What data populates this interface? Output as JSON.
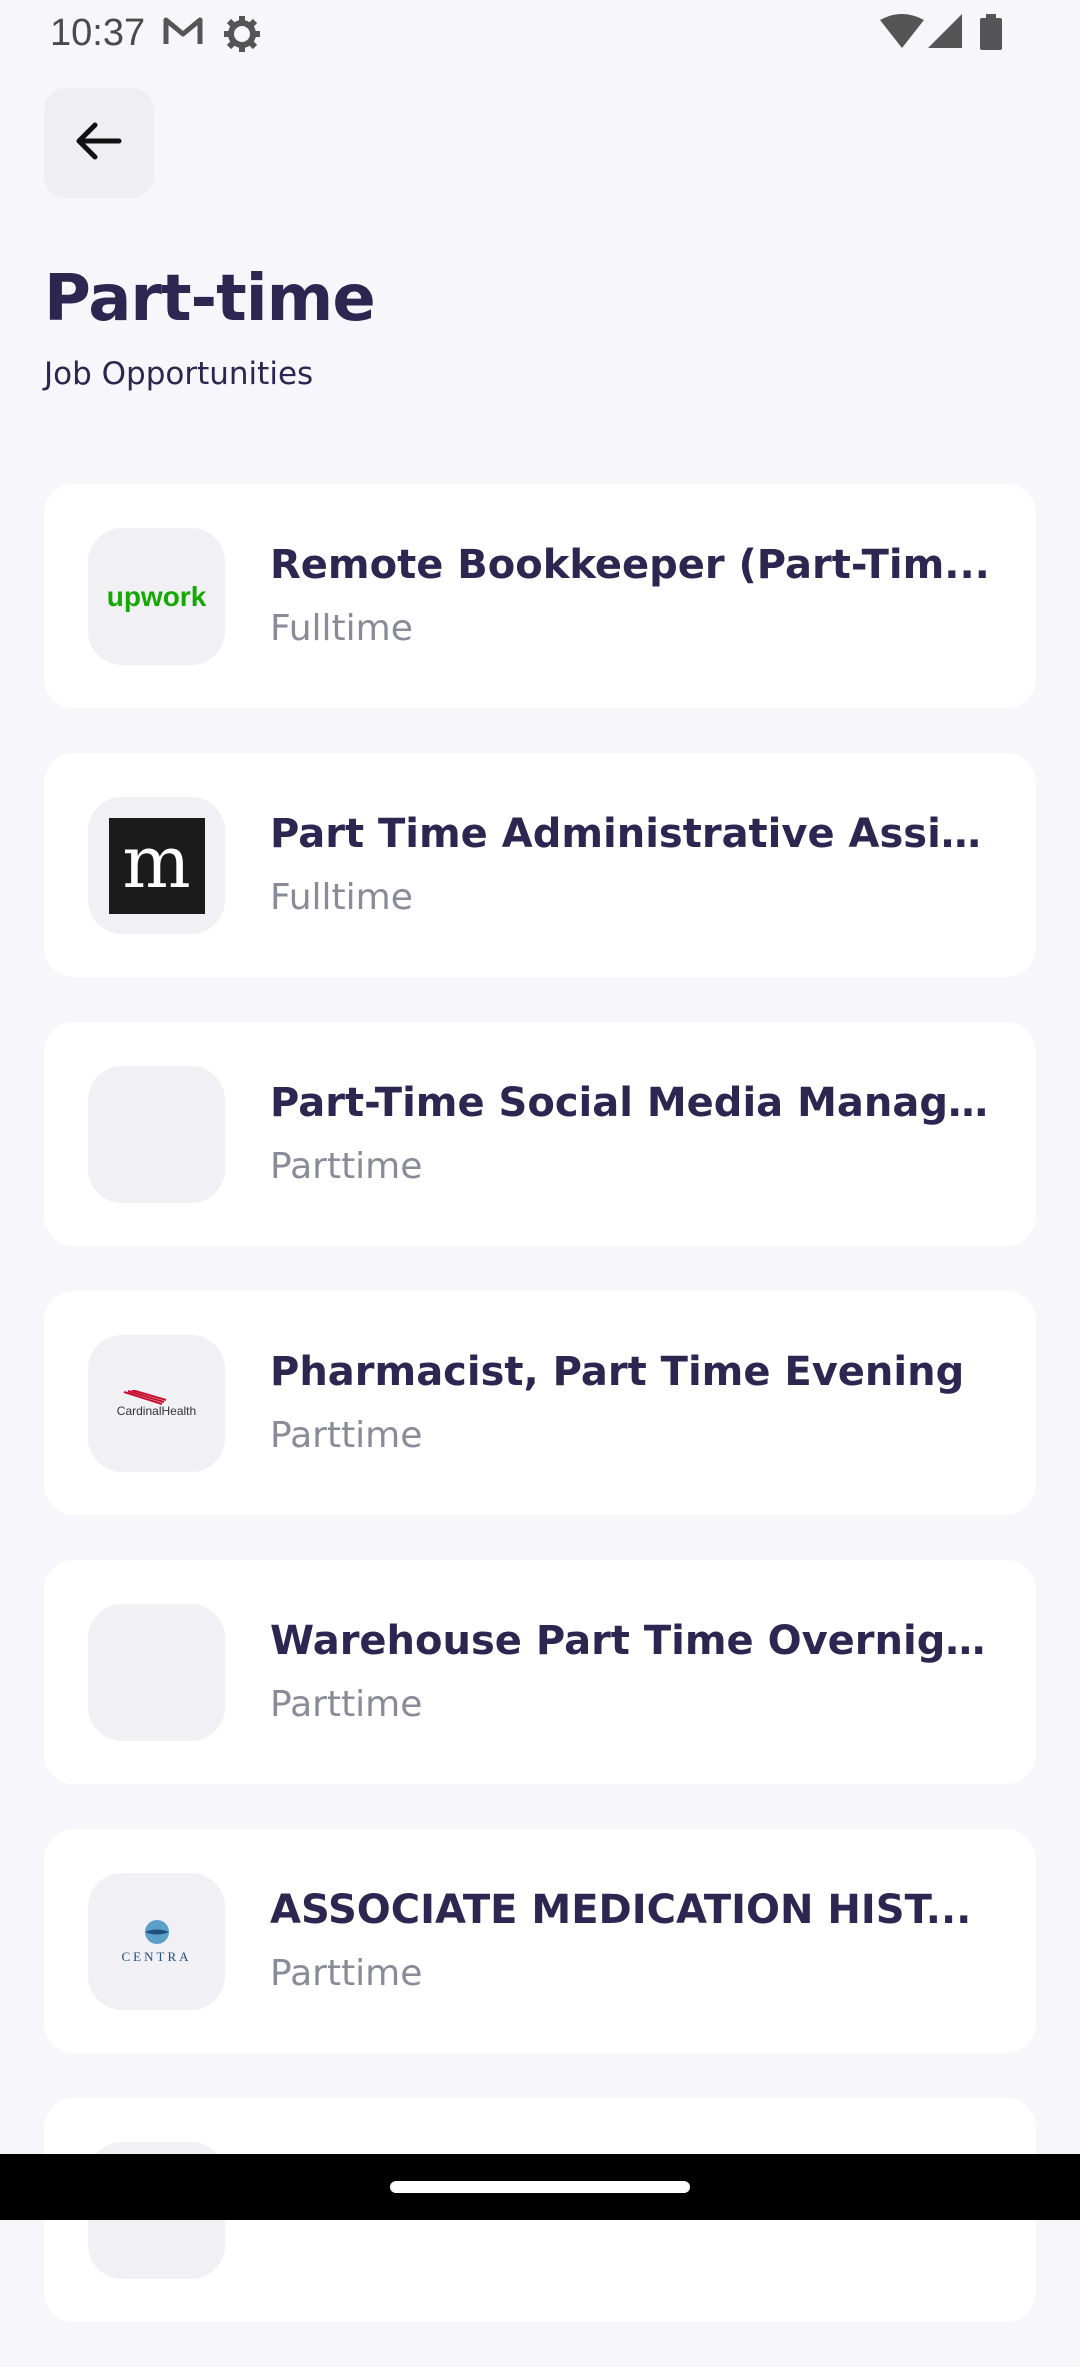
{
  "status_bar": {
    "time": "10:37",
    "icons": [
      "gmail-icon",
      "settings-icon",
      "wifi-icon",
      "signal-icon",
      "battery-icon"
    ]
  },
  "header": {
    "back_icon": "arrow-left-icon",
    "title": "Part-time",
    "subtitle": "Job Opportunities"
  },
  "jobs": [
    {
      "title": "Remote Bookkeeper (Part-Tim...",
      "type": "Fulltime",
      "logo": "upwork-logo",
      "logo_text": "upwork"
    },
    {
      "title": "Part Time Administrative Assis...",
      "type": "Fulltime",
      "logo": "m-logo",
      "logo_text": "m"
    },
    {
      "title": "Part-Time Social Media Manag...",
      "type": "Parttime",
      "logo": "blank-logo",
      "logo_text": ""
    },
    {
      "title": "Pharmacist, Part Time Evening",
      "type": "Parttime",
      "logo": "cardinal-health-logo",
      "logo_text": "CardinalHealth"
    },
    {
      "title": "Warehouse Part Time Overnight",
      "type": "Parttime",
      "logo": "blank-logo",
      "logo_text": ""
    },
    {
      "title": "ASSOCIATE MEDICATION HIST...",
      "type": "Parttime",
      "logo": "centra-logo",
      "logo_text": "CENTRA"
    }
  ],
  "colors": {
    "background": "#f7f7fb",
    "card": "#ffffff",
    "title": "#2d2650",
    "muted": "#8a8a98",
    "upwork_green": "#14a800"
  }
}
